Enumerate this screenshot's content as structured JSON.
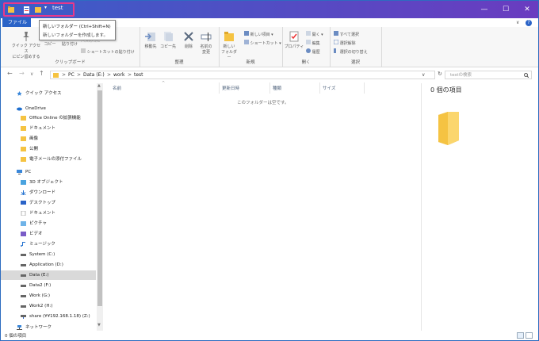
{
  "window": {
    "title": "test",
    "minimize": "—",
    "maximize": "☐",
    "close": "✕"
  },
  "ribbon_tabs": {
    "file": "ファイル"
  },
  "tooltip": {
    "title": "新しいフォルダー (Ctrl+Shift+N)",
    "description": "新しいフォルダーを作成します。"
  },
  "ribbon": {
    "clipboard": {
      "group_label": "クリップボード",
      "pin_label_1": "クイック アクセス",
      "pin_label_2": "にピン留めする",
      "copy": "コピー",
      "paste": "貼り付け",
      "copy_path": "パスのコピー",
      "paste_shortcut": "ショートカットの貼り付け"
    },
    "organize": {
      "group_label": "整理",
      "move_to": "移動先",
      "copy_to": "コピー先",
      "delete": "削除",
      "rename_1": "名前の",
      "rename_2": "変更"
    },
    "new": {
      "group_label": "新規",
      "new_folder_1": "新しい",
      "new_folder_2": "フォルダー",
      "new_item": "新しい項目 ▾",
      "shortcut": "ショートカット ▾"
    },
    "open": {
      "group_label": "開く",
      "properties": "プロパティ",
      "open": "開く ▾",
      "edit": "編集",
      "history": "履歴"
    },
    "select": {
      "group_label": "選択",
      "select_all": "すべて選択",
      "select_none": "選択解除",
      "invert": "選択の切り替え"
    }
  },
  "address": {
    "back": "←",
    "forward": "→",
    "recent": "∨",
    "up": "↑",
    "crumbs": [
      "PC",
      "Data (E:)",
      "work",
      "test"
    ],
    "separator": ">",
    "dropdown": "∨",
    "refresh": "↻",
    "search_placeholder": "testの検索"
  },
  "nav": {
    "quick_access": "クイック アクセス",
    "onedrive": "OneDrive",
    "onedrive_items": [
      "Office Online の拡張機能",
      "ドキュメント",
      "画像",
      "公開",
      "電子メールの添付ファイル"
    ],
    "pc": "PC",
    "pc_items": [
      "3D オブジェクト",
      "ダウンロード",
      "デスクトップ",
      "ドキュメント",
      "ピクチャ",
      "ビデオ",
      "ミュージック",
      "System (C:)",
      "Application (D:)",
      "Data (E:)",
      "Data2 (F:)",
      "Work (G:)",
      "Work2 (H:)",
      "share (¥¥192.168.1.18) (Z:)"
    ],
    "network": "ネットワーク"
  },
  "columns": [
    "名前",
    "更新日時",
    "種類",
    "サイズ"
  ],
  "empty_message": "このフォルダーは空です。",
  "preview": "0 個の項目",
  "status": "0 個の項目",
  "colors": {
    "accent": "#2a63c7",
    "highlight": "#e8388a",
    "folder": "#f5c342"
  }
}
